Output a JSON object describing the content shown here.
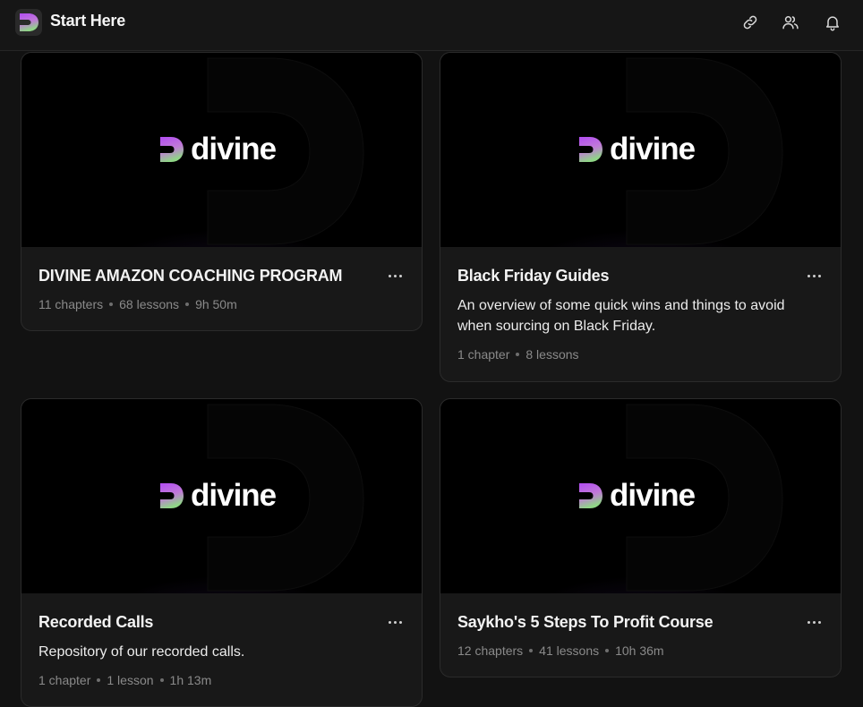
{
  "header": {
    "title": "Start Here",
    "icons": [
      "link-icon",
      "users-icon",
      "bell-icon"
    ]
  },
  "brand": {
    "wordmark": "divine",
    "gradient": [
      "#b04cf0",
      "#8fd17a"
    ]
  },
  "courses": [
    {
      "title": "DIVINE AMAZON COACHING PROGRAM",
      "description": "",
      "meta": [
        "11 chapters",
        "68 lessons",
        "9h 50m"
      ]
    },
    {
      "title": "Black Friday Guides",
      "description": "An overview of some quick wins and things to avoid when sourcing on Black Friday.",
      "meta": [
        "1 chapter",
        "8 lessons"
      ]
    },
    {
      "title": "Recorded Calls",
      "description": "Repository of our recorded calls.",
      "meta": [
        "1 chapter",
        "1 lesson",
        "1h 13m"
      ]
    },
    {
      "title": "Saykho's 5 Steps To Profit Course",
      "description": "",
      "meta": [
        "12 chapters",
        "41 lessons",
        "10h 36m"
      ]
    }
  ]
}
